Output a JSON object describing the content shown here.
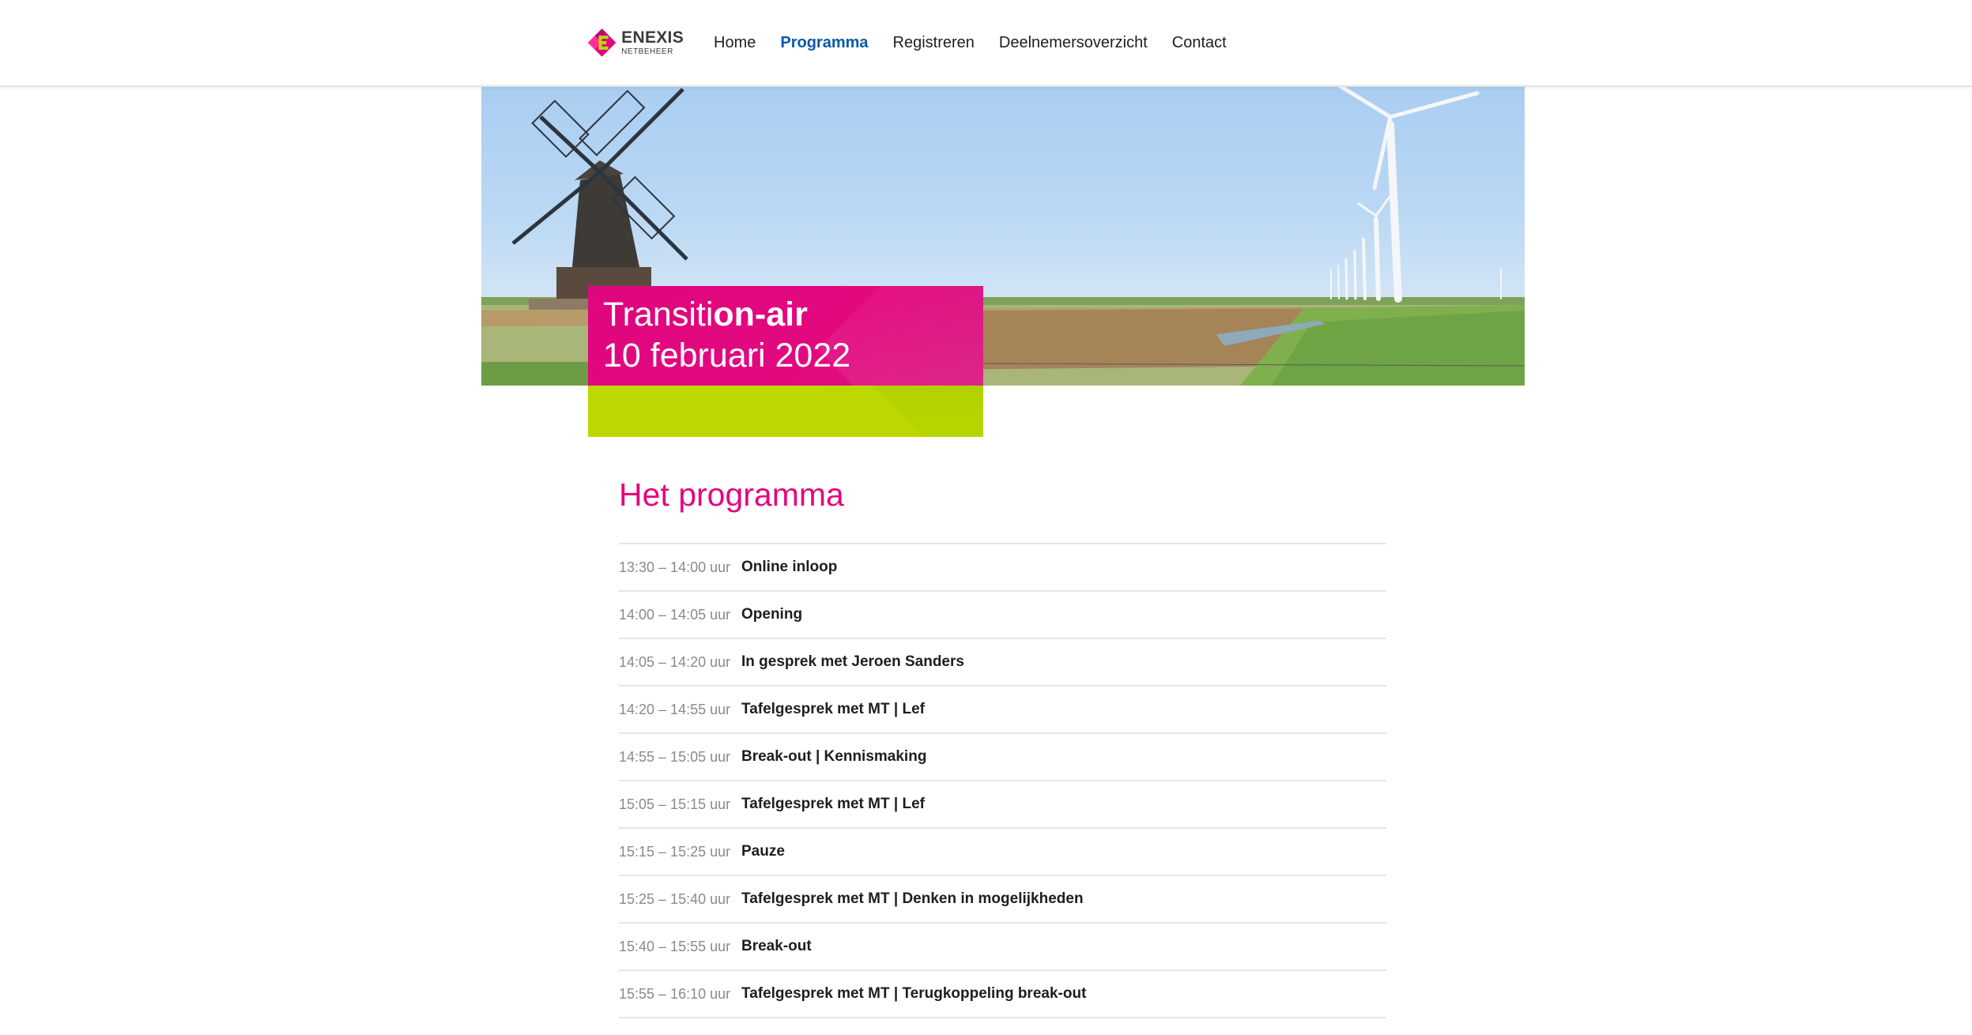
{
  "brand": {
    "name": "ENEXIS",
    "sub": "NETBEHEER",
    "logo_icon": "enexis-e-logo",
    "colors": {
      "magenta": "#e2067e",
      "lime": "#bcd800",
      "nav_active": "#0a5aa4"
    }
  },
  "nav": {
    "items": [
      {
        "label": "Home",
        "active": false
      },
      {
        "label": "Programma",
        "active": true
      },
      {
        "label": "Registreren",
        "active": false
      },
      {
        "label": "Deelnemersoverzicht",
        "active": false
      },
      {
        "label": "Contact",
        "active": false
      }
    ]
  },
  "hero": {
    "image": "windmill-and-wind-turbines-landscape",
    "title_regular": "Transiti",
    "title_bold": "on-air",
    "date": "10 februari 2022"
  },
  "program": {
    "heading": "Het programma",
    "rows": [
      {
        "time": "13:30 – 14:00 uur",
        "item": "Online inloop"
      },
      {
        "time": "14:00 – 14:05 uur",
        "item": "Opening"
      },
      {
        "time": "14:05 – 14:20 uur",
        "item": "In gesprek met Jeroen Sanders"
      },
      {
        "time": "14:20 – 14:55 uur",
        "item": "Tafelgesprek met MT | Lef"
      },
      {
        "time": "14:55 – 15:05 uur",
        "item": "Break-out | Kennismaking"
      },
      {
        "time": "15:05 – 15:15 uur",
        "item": "Tafelgesprek met MT | Lef"
      },
      {
        "time": "15:15 – 15:25 uur",
        "item": "Pauze"
      },
      {
        "time": "15:25 – 15:40 uur",
        "item": "Tafelgesprek met MT | Denken in mogelijkheden"
      },
      {
        "time": "15:40 – 15:55 uur",
        "item": "Break-out"
      },
      {
        "time": "15:55 – 16:10 uur",
        "item": "Tafelgesprek met MT | Terugkoppeling break-out"
      }
    ]
  }
}
